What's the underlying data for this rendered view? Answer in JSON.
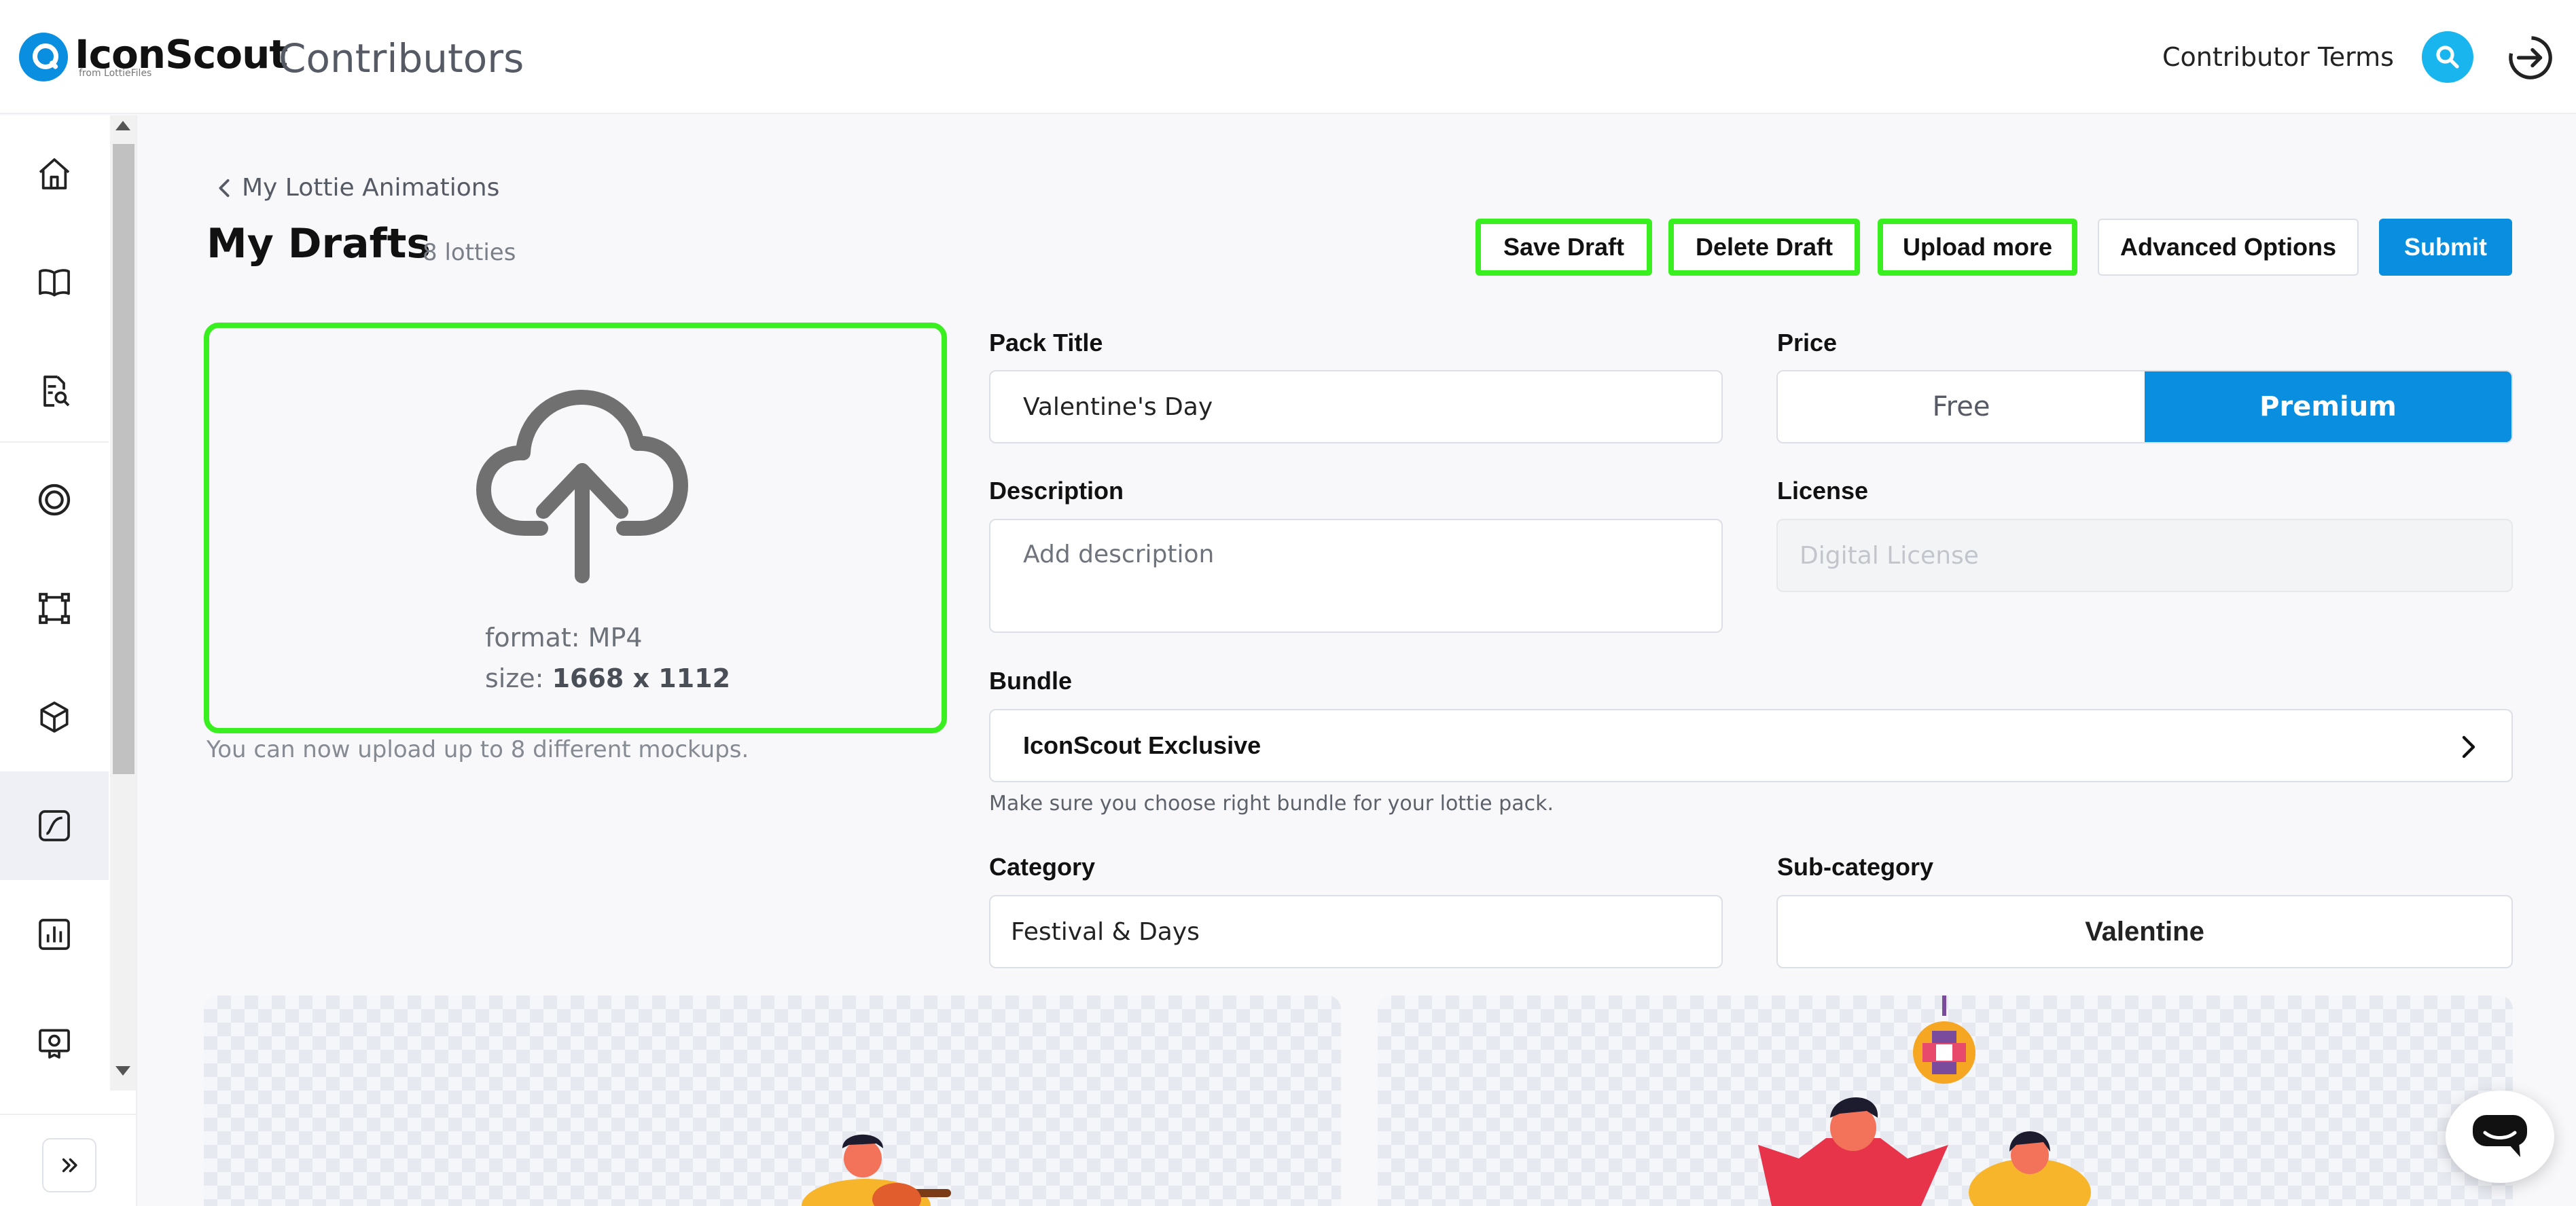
{
  "header": {
    "logo_name": "IconScout",
    "logo_sub": "from LottieFiles",
    "app_title": "Contributors",
    "terms_link": "Contributor Terms"
  },
  "sidebar": {
    "icons": [
      "home-icon",
      "book-icon",
      "document-search-icon",
      "target-icon",
      "vector-icon",
      "cube-icon",
      "lottie-icon",
      "chart-icon",
      "badge-icon"
    ],
    "active": "lottie-icon"
  },
  "main": {
    "breadcrumb": "My Lottie Animations",
    "title": "My Drafts",
    "count": "8 lotties",
    "actions": {
      "save_draft": "Save Draft",
      "delete_draft": "Delete Draft",
      "upload_more": "Upload more",
      "advanced_options": "Advanced Options",
      "submit": "Submit"
    },
    "upload": {
      "format_label": "format: MP4",
      "size_label": "size:",
      "size_value": "1668 x 1112",
      "note": "You can now upload up to 8 different mockups."
    },
    "form": {
      "pack_title_label": "Pack Title",
      "pack_title_value": "Valentine's Day",
      "price_label": "Price",
      "price_options": [
        "Free",
        "Premium"
      ],
      "price_selected": "Premium",
      "description_label": "Description",
      "description_placeholder": "Add description",
      "license_label": "License",
      "license_value": "Digital License",
      "bundle_label": "Bundle",
      "bundle_value": "IconScout Exclusive",
      "bundle_hint": "Make sure you choose right bundle for your lottie pack.",
      "category_label": "Category",
      "category_value": "Festival & Days",
      "subcategory_label": "Sub-category",
      "subcategory_value": "Valentine"
    }
  },
  "colors": {
    "accent": "#0a8ee0",
    "highlight": "#3aef1f"
  }
}
